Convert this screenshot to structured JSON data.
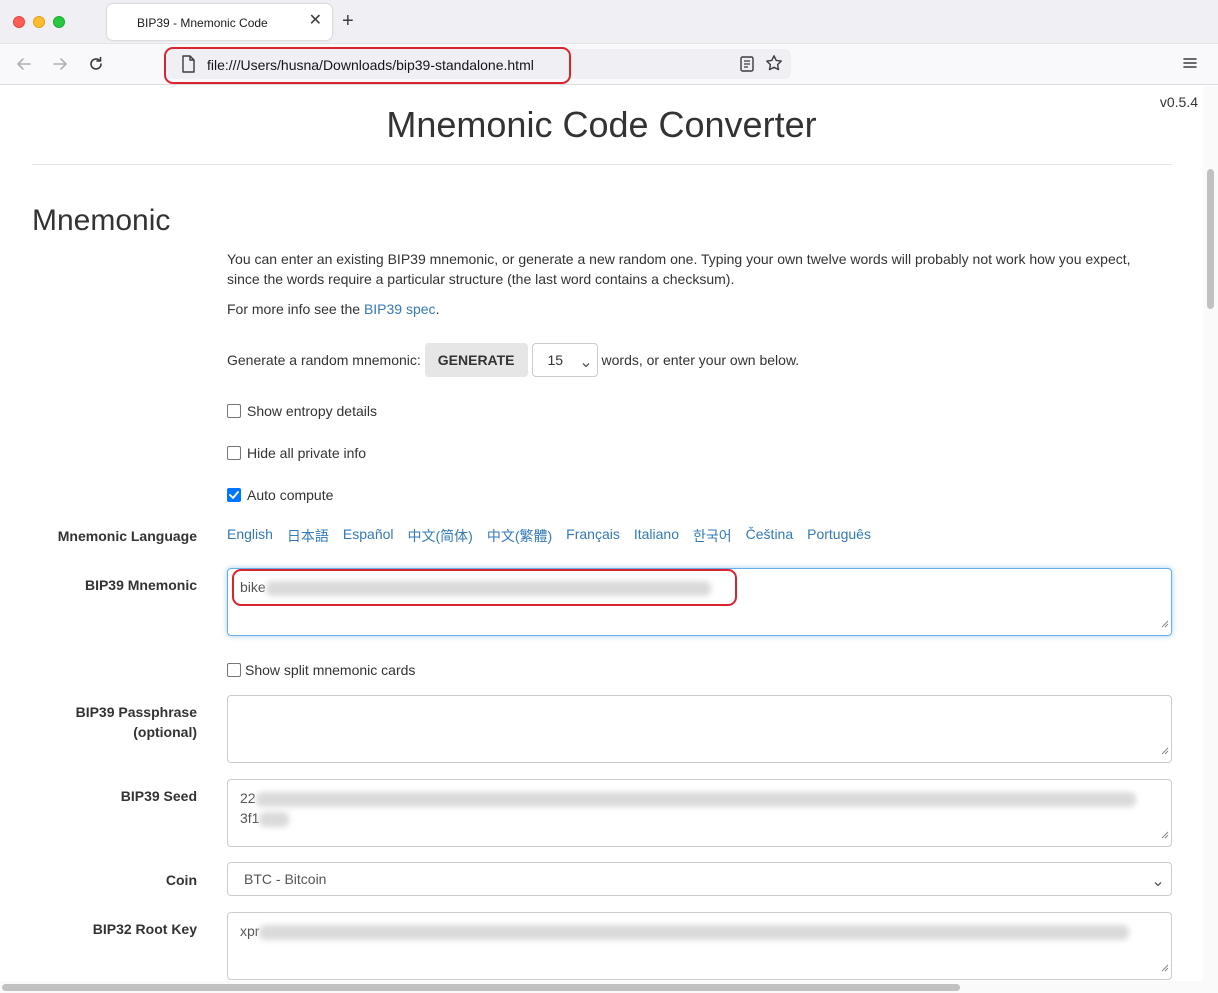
{
  "browser": {
    "tab_title": "BIP39 - Mnemonic Code",
    "tab_close": "✕",
    "new_tab": "+",
    "url": "file:///Users/husna/Downloads/bip39-standalone.html"
  },
  "page": {
    "version": "v0.5.4",
    "title": "Mnemonic Code Converter",
    "section_title": "Mnemonic",
    "intro_1": "You can enter an existing BIP39 mnemonic, or generate a new random one. Typing your own twelve words will probably not work how you expect, since the words require a particular structure (the last word contains a checksum).",
    "more_info_prefix": "For more info see the ",
    "more_info_link": "BIP39 spec",
    "more_info_suffix": ".",
    "generate_prefix": "Generate a random mnemonic:",
    "generate_button": "GENERATE",
    "word_count": "15",
    "generate_suffix": "words, or enter your own below.",
    "show_entropy": "Show entropy details",
    "hide_private": "Hide all private info",
    "auto_compute": "Auto compute",
    "auto_compute_checked": true,
    "mnemonic_language_label": "Mnemonic Language",
    "languages": [
      "English",
      "日本語",
      "Español",
      "中文(简体)",
      "中文(繁體)",
      "Français",
      "Italiano",
      "한국어",
      "Čeština",
      "Português"
    ],
    "bip39_mnemonic_label": "BIP39 Mnemonic",
    "bip39_mnemonic_value": "bike",
    "show_split_cards": "Show split mnemonic cards",
    "passphrase_label_1": "BIP39 Passphrase",
    "passphrase_label_2": "(optional)",
    "seed_label": "BIP39 Seed",
    "seed_line_1": "22",
    "seed_line_2": "3f1",
    "coin_label": "Coin",
    "coin_value": "BTC - Bitcoin",
    "root_key_label": "BIP32 Root Key",
    "root_key_value": "xpr"
  },
  "colors": {
    "link": "#337ab7",
    "highlight": "#d9232f",
    "checkbox_checked": "#0075ff"
  }
}
